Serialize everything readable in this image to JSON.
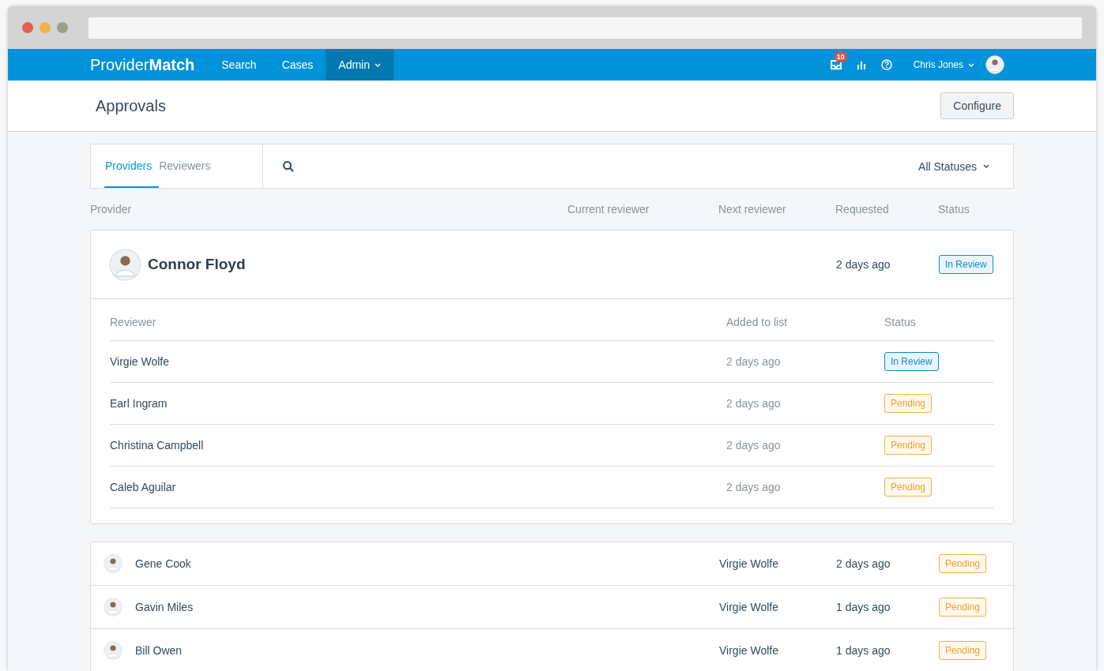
{
  "nav": {
    "brand": "Provider**Match**",
    "items": [
      {
        "label": "Search",
        "selected": false,
        "dropdown": false
      },
      {
        "label": "Cases",
        "selected": false,
        "dropdown": false
      },
      {
        "label": "Admin",
        "selected": true,
        "dropdown": true
      }
    ],
    "notification_count": "10",
    "user": "Chris Jones"
  },
  "header": {
    "title": "Approvals",
    "button": "Configure"
  },
  "tabs": [
    {
      "label": "Providers",
      "selected": true
    },
    {
      "label": "Reviewers",
      "selected": false
    }
  ],
  "filter": "All Statuses",
  "columns": [
    "Provider",
    "Current reviewer",
    "Next reviewer",
    "Requested",
    "Status"
  ],
  "providers": [
    {
      "name": "Connor Floyd",
      "requested": "2 days ago",
      "status": {
        "label": "In Review",
        "kind": "review"
      },
      "expanded": true,
      "reviewer_columns": [
        "Reviewer",
        "Added to list",
        "Status"
      ],
      "reviewers": [
        {
          "name": "Virgie Wolfe",
          "added": "2 days ago",
          "status": {
            "label": "In Review",
            "kind": "review"
          }
        },
        {
          "name": "Earl Ingram",
          "added": "2 days ago",
          "status": {
            "label": "Pending",
            "kind": "pending"
          }
        },
        {
          "name": "Christina Campbell",
          "added": "2 days ago",
          "status": {
            "label": "Pending",
            "kind": "pending"
          }
        },
        {
          "name": "Caleb Aguilar",
          "added": "2 days ago",
          "status": {
            "label": "Pending",
            "kind": "pending"
          }
        }
      ]
    },
    {
      "name": "Gene Cook",
      "next_reviewer": "Virgie Wolfe",
      "requested": "2 days ago",
      "status": {
        "label": "Pending",
        "kind": "pending"
      },
      "expanded": false
    },
    {
      "name": "Gavin Miles",
      "next_reviewer": "Virgie Wolfe",
      "requested": "1 days ago",
      "status": {
        "label": "Pending",
        "kind": "pending"
      },
      "expanded": false
    },
    {
      "name": "Bill Owen",
      "next_reviewer": "Virgie Wolfe",
      "requested": "1 days ago",
      "status": {
        "label": "Pending",
        "kind": "pending"
      },
      "expanded": false
    }
  ]
}
